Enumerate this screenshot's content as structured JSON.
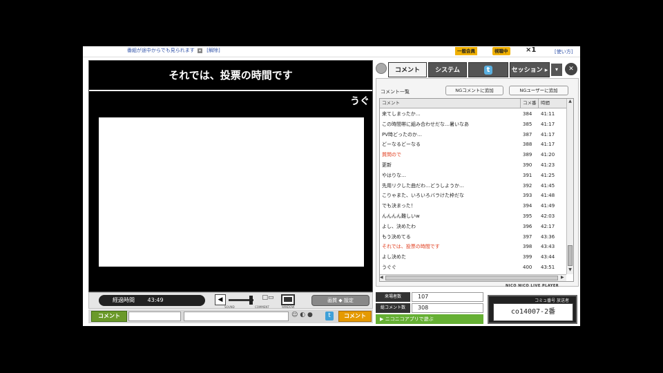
{
  "top": {
    "notice": "番組が途中からでも見られます",
    "notice_badge": "▾",
    "notice_link": "[解除]",
    "premium_label": "一般会員",
    "count_label": "視聴中",
    "count_multiplier": "×1",
    "help_link": "[使い方]"
  },
  "player": {
    "title": "それでは、投票の時間です",
    "scrolling_comment": "うぐ"
  },
  "controls": {
    "elapsed_label": "経過時間",
    "elapsed_value": "43:49",
    "speaker_glyph": "◀",
    "comment_glyph": "□▭",
    "caption_sound": "SOUND",
    "caption_comment": "COMMENT",
    "caption_window": "WINDOW",
    "quality_label": "画質 ◆ 設定"
  },
  "comment_bar": {
    "label": "コメント",
    "tool_glyphs": "☺ ◐ ●",
    "twitter_glyph": "t",
    "submit_label": "コメント"
  },
  "side": {
    "tabs": [
      "コメント",
      "システム",
      "",
      "セッション ▸"
    ],
    "twitter_glyph": "t",
    "dropdown_glyph": "▾",
    "close_glyph": "✕",
    "list_heading": "コメント一覧",
    "ng_comment_button": "NGコメントに追加",
    "ng_user_button": "NGユーザーに追加",
    "columns": [
      "コメント",
      "コメ番",
      "時間"
    ],
    "rows": [
      {
        "comment": "来てしまったか…",
        "no": "384",
        "time": "41:11",
        "red": false
      },
      {
        "comment": "この時間帯に組み合わせだな…暑いなあ",
        "no": "385",
        "time": "41:17",
        "red": false
      },
      {
        "comment": "PV時どったのか…",
        "no": "387",
        "time": "41:17",
        "red": false
      },
      {
        "comment": "どーなるどーなる",
        "no": "388",
        "time": "41:17",
        "red": false
      },
      {
        "comment": "質問ので",
        "no": "389",
        "time": "41:20",
        "red": true
      },
      {
        "comment": "更新",
        "no": "390",
        "time": "41:23",
        "red": false
      },
      {
        "comment": "やはりな…",
        "no": "391",
        "time": "41:25",
        "red": false
      },
      {
        "comment": "先用リクした曲だわ…どうしようか…",
        "no": "392",
        "time": "41:45",
        "red": false
      },
      {
        "comment": "こりゃまた、いろいろバラけた枠だな",
        "no": "393",
        "time": "41:48",
        "red": false
      },
      {
        "comment": "でも決まった！",
        "no": "394",
        "time": "41:49",
        "red": false
      },
      {
        "comment": "んんんん難しいw",
        "no": "395",
        "time": "42:03",
        "red": false
      },
      {
        "comment": "よし、決めたわ",
        "no": "396",
        "time": "42:17",
        "red": false
      },
      {
        "comment": "もう決めてる",
        "no": "397",
        "time": "43:36",
        "red": false
      },
      {
        "comment": "それでは、投票の時間です",
        "no": "398",
        "time": "43:43",
        "red": true
      },
      {
        "comment": "よし決めた",
        "no": "399",
        "time": "43:44",
        "red": false
      },
      {
        "comment": "うぐぐ",
        "no": "400",
        "time": "43:51",
        "red": false
      }
    ],
    "scroll_up": "▲",
    "scroll_down": "▼",
    "scroll_left": "◀",
    "scroll_right": "▶",
    "brand": "NICO NICO LIVE PLAYER"
  },
  "stats": {
    "viewers_label": "来場者数",
    "viewers_value": "107",
    "comments_label": "総コメント数",
    "comments_value": "308",
    "app_link": "▶ ニコニコアプリで遊ぶ"
  },
  "channel": {
    "caption": "コミュ番号 放送者",
    "id": "co14007-2番"
  },
  "colors": {
    "comment_red": "#e03a1a",
    "comment_green": "#6b9a2a",
    "submit_orange": "#e59a00",
    "twitter_blue": "#3fa0d8"
  }
}
